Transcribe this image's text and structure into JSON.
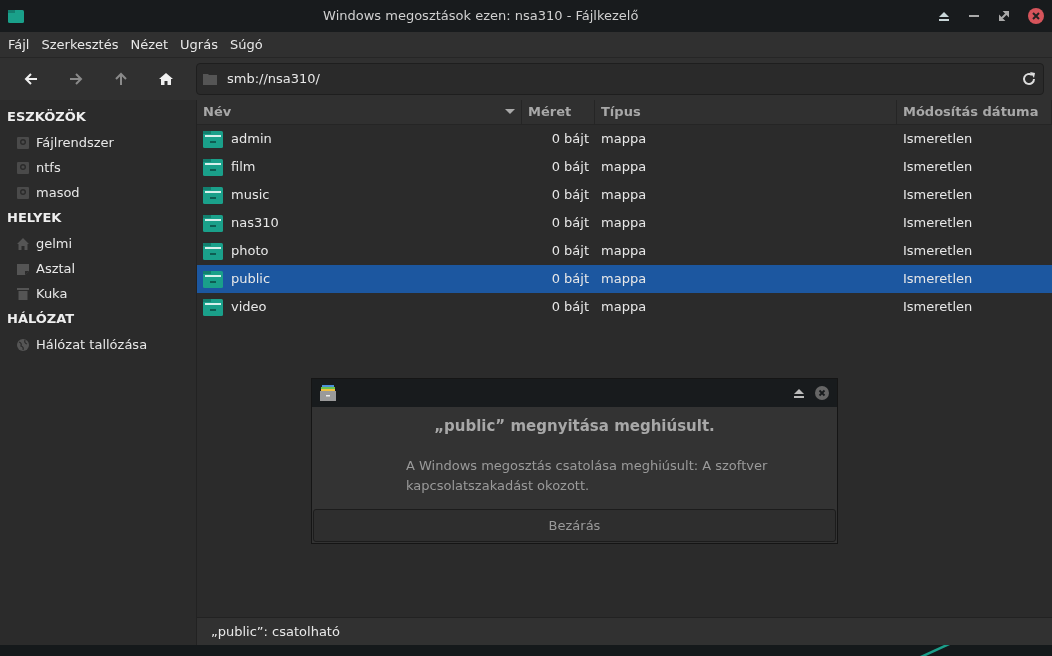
{
  "window": {
    "title": "Windows megosztások ezen: nsa310 - Fájlkezelő"
  },
  "menu": [
    "Fájl",
    "Szerkesztés",
    "Nézet",
    "Ugrás",
    "Súgó"
  ],
  "toolbar": {
    "back_disabled": false,
    "forward_disabled": true,
    "up_disabled": true,
    "location": "smb://nsa310/"
  },
  "sidebar": [
    {
      "heading": "ESZKÖZÖK",
      "items": [
        {
          "label": "Fájlrendszer",
          "kind": "drive"
        },
        {
          "label": "ntfs",
          "kind": "drive"
        },
        {
          "label": "masod",
          "kind": "drive"
        }
      ]
    },
    {
      "heading": "HELYEK",
      "items": [
        {
          "label": "gelmi",
          "kind": "home"
        },
        {
          "label": "Asztal",
          "kind": "desktop"
        },
        {
          "label": "Kuka",
          "kind": "trash"
        }
      ]
    },
    {
      "heading": "HÁLÓZAT",
      "items": [
        {
          "label": "Hálózat tallózása",
          "kind": "network"
        }
      ]
    }
  ],
  "table": {
    "columns": [
      {
        "label": "Név",
        "sorted": true
      },
      {
        "label": "Méret",
        "sorted": false
      },
      {
        "label": "Típus",
        "sorted": false
      },
      {
        "label": "Módosítás dátuma",
        "sorted": false
      }
    ],
    "rows": [
      {
        "name": "admin",
        "size": "0 bájt",
        "type": "mappa",
        "modified": "Ismeretlen",
        "selected": false
      },
      {
        "name": "film",
        "size": "0 bájt",
        "type": "mappa",
        "modified": "Ismeretlen",
        "selected": false
      },
      {
        "name": "music",
        "size": "0 bájt",
        "type": "mappa",
        "modified": "Ismeretlen",
        "selected": false
      },
      {
        "name": "nas310",
        "size": "0 bájt",
        "type": "mappa",
        "modified": "Ismeretlen",
        "selected": false
      },
      {
        "name": "photo",
        "size": "0 bájt",
        "type": "mappa",
        "modified": "Ismeretlen",
        "selected": false
      },
      {
        "name": "public",
        "size": "0 bájt",
        "type": "mappa",
        "modified": "Ismeretlen",
        "selected": true
      },
      {
        "name": "video",
        "size": "0 bájt",
        "type": "mappa",
        "modified": "Ismeretlen",
        "selected": false
      }
    ]
  },
  "dialog": {
    "title": "„public” megnyitása meghiúsult.",
    "message": "A Windows megosztás csatolása meghiúsult: A szoftver kapcsolatszakadást okozott.",
    "button": "Bezárás"
  },
  "status_bar": "„public”: csatolható"
}
